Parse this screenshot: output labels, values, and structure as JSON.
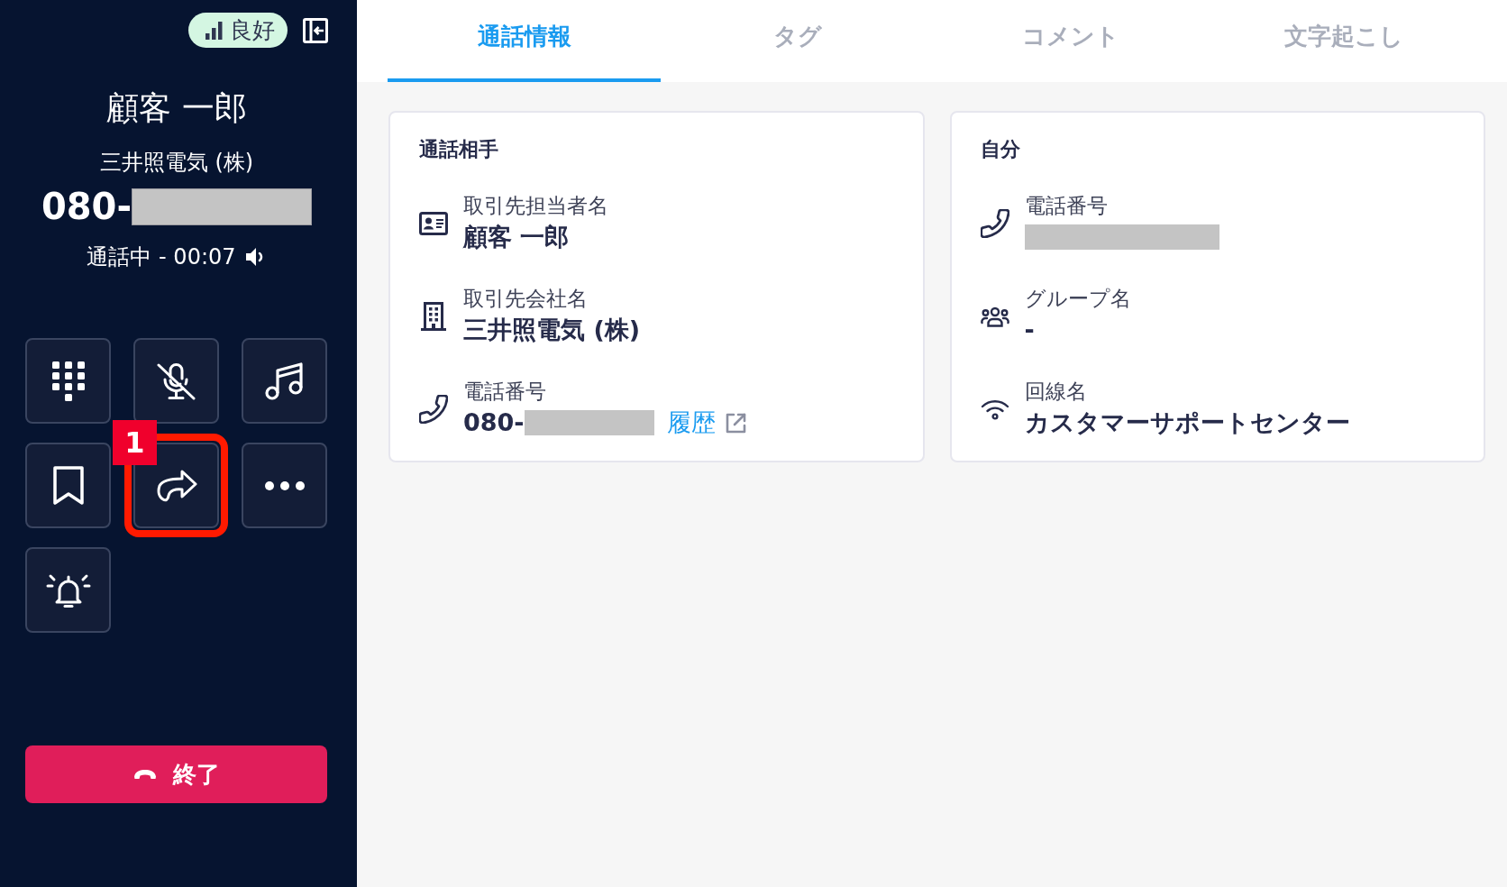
{
  "sidebar": {
    "connection": {
      "label": "良好"
    },
    "caller": {
      "name": "顧客 一郎",
      "company": "三井照電気 (株)",
      "phone": "080-",
      "phone_redacted": true,
      "status": "通話中 - 00:07"
    },
    "actions": [
      {
        "kind": "keypad",
        "highlighted": false
      },
      {
        "kind": "mute",
        "highlighted": false
      },
      {
        "kind": "music",
        "highlighted": false
      },
      {
        "kind": "bookmark",
        "highlighted": false
      },
      {
        "kind": "forward",
        "highlighted": true,
        "callout": "1"
      },
      {
        "kind": "more",
        "highlighted": false
      },
      {
        "kind": "alarm",
        "highlighted": false
      }
    ],
    "end_button": {
      "label": "終了"
    }
  },
  "tabs": [
    {
      "label": "通話情報",
      "selected": true
    },
    {
      "label": "タグ",
      "selected": false
    },
    {
      "label": "コメント",
      "selected": false
    },
    {
      "label": "文字起こし",
      "selected": false
    }
  ],
  "cards": [
    {
      "title": "通話相手",
      "fields": [
        {
          "kind": "contact",
          "label": "取引先担当者名",
          "value": "顧客 一郎",
          "redacted": false
        },
        {
          "kind": "company",
          "label": "取引先会社名",
          "value": "三井照電気 (株)",
          "redacted": false
        },
        {
          "kind": "phone",
          "label": "電話番号",
          "value": "080-",
          "redacted": true,
          "link": "履歴"
        }
      ]
    },
    {
      "title": "自分",
      "fields": [
        {
          "kind": "phone",
          "label": "電話番号",
          "redacted": true
        },
        {
          "kind": "group",
          "label": "グループ名",
          "value": "-",
          "redacted": false
        },
        {
          "kind": "line",
          "label": "回線名",
          "value": "カスタマーサポートセンター",
          "redacted": false
        }
      ]
    }
  ]
}
